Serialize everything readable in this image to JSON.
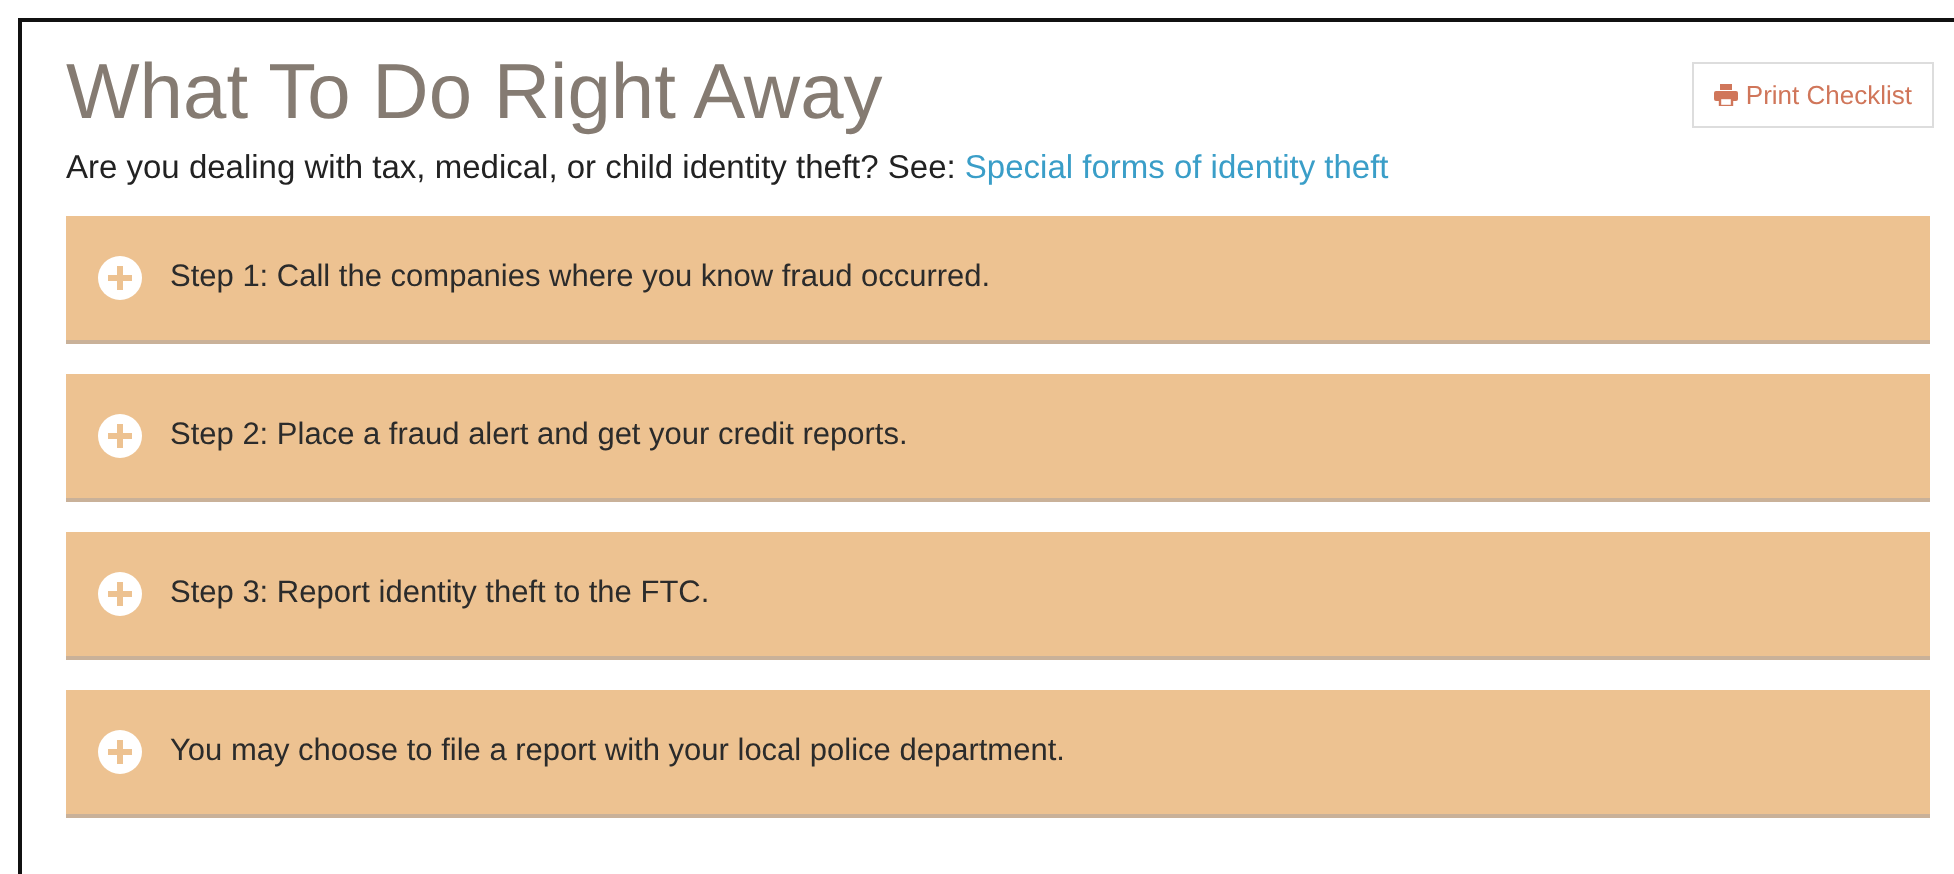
{
  "title": "What To Do Right Away",
  "print_button": {
    "label": "Print Checklist"
  },
  "intro": {
    "text": "Are you dealing with tax, medical, or child identity theft? See:",
    "link": "Special forms of identity theft"
  },
  "steps": [
    {
      "label": "Step 1: Call the companies where you know fraud occurred.",
      "expanded": false
    },
    {
      "label": "Step 2: Place a fraud alert and get your credit reports.",
      "expanded": false
    },
    {
      "label": "Step 3: Report identity theft to the FTC.",
      "expanded": false
    },
    {
      "label": "You may choose to file a report with your local police department.",
      "expanded": false
    }
  ]
}
